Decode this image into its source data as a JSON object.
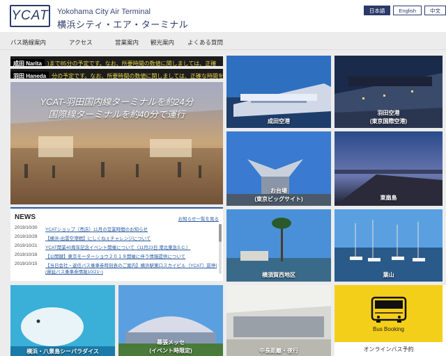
{
  "header": {
    "logo_text": "YCAT",
    "subtitle_en": "Yokohama City Air Terminal",
    "subtitle_jp": "横浜シティ・エア・ターミナル",
    "lang": [
      "日本語",
      "English",
      "中文"
    ]
  },
  "nav": {
    "items": [
      "バス路線案内",
      "アクセス",
      "営業案内",
      "観光案内",
      "よくある質問"
    ]
  },
  "ticker": {
    "narita_label": "成田 Narita",
    "narita_text": ")まで85分の予定です。なお、所要時間の数値に関しましては、正確",
    "haneda_label": "羽田 Haneda",
    "haneda_text": "分の予定です。なお、所要時間の数値に関しましては、正確な時間を"
  },
  "hero": {
    "line1": "YCAT-羽田国内線ターミナルを約24分",
    "line2": "国際線ターミナルを約40分で運行"
  },
  "news": {
    "title": "NEWS",
    "more": "お知らせ一覧を見る",
    "items": [
      {
        "date": "2019/10/30",
        "text": "YCATショップ（売店）11月の営業時間のお知らせ"
      },
      {
        "date": "2019/10/29",
        "text": "【横浜-出雲空港間】にしくねぇチャレンジについて"
      },
      {
        "date": "2019/10/21",
        "text": "YCAT開業40周年記念イベント開催について（11月23日 港北東急S.C.）"
      },
      {
        "date": "2019/10/16",
        "text": "【公開鍵】東京モーターショウ２０１９開催に伴う情報提供について"
      },
      {
        "date": "2019/10/15",
        "text": "【当日会社・返信バス乗車券時刻表のご案内】横浜駅東口スカイビル（YCAT）前停留所"
      },
      {
        "date": "",
        "text": "(遅延バス乗車券情報10/21~)"
      }
    ]
  },
  "tiles": {
    "narita": "成田空港",
    "haneda1": "羽田空港",
    "haneda2": "(東京国際空港)",
    "odaiba1": "お台場",
    "odaiba2": "(東京ビッグサイト)",
    "shinjuku": "東扇島",
    "yokosuka": "横須賀西地区",
    "hayama": "葉山",
    "hakkeijima": "横浜・八景島シーパラダイス",
    "makuhari1": "幕張メッセ",
    "makuhari2": "(イベント時限定)",
    "nighttrain": "中長距離・夜行"
  },
  "bus": {
    "label": "Bus Booking",
    "sub": "オンラインバス予約"
  },
  "colors": {
    "accent": "#2a3a6a",
    "bus_yellow": "#f4cf1a"
  }
}
